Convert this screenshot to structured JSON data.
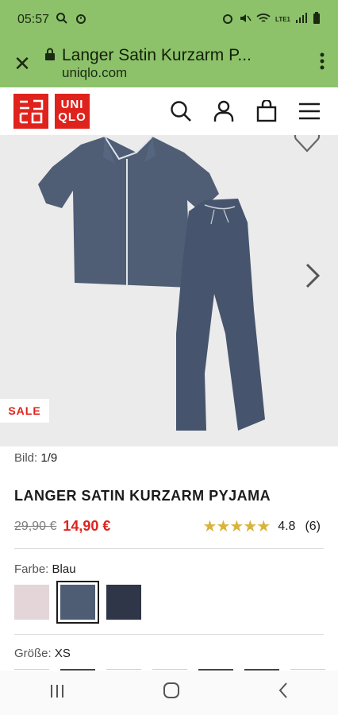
{
  "status_bar": {
    "time": "05:57",
    "network": "LTE1"
  },
  "browser": {
    "page_title": "Langer Satin Kurzarm P...",
    "domain": "uniqlo.com"
  },
  "header": {
    "logo_top": "ユニ\nクロ",
    "logo_bottom": "UNI\nQLO"
  },
  "gallery": {
    "badge": "SALE",
    "counter_label": "Bild:",
    "counter_value": "1/9"
  },
  "product": {
    "title": "LANGER SATIN KURZARM PYJAMA",
    "old_price": "29,90 €",
    "price": "14,90 €",
    "rating_stars": "★★★★★",
    "rating_value": "4.8",
    "rating_count": "(6)"
  },
  "color": {
    "label": "Farbe:",
    "value": "Blau",
    "swatches": [
      {
        "name": "Rosa",
        "hex": "#e3d5d8",
        "selected": false
      },
      {
        "name": "Blau",
        "hex": "#4e5d74",
        "selected": true
      },
      {
        "name": "Navy",
        "hex": "#2e3648",
        "selected": false
      }
    ]
  },
  "size": {
    "label": "Größe:",
    "value": "XS"
  },
  "colors": {
    "status_bar": "#8dc26b",
    "brand_red": "#e0221c",
    "star": "#d9b33a"
  }
}
